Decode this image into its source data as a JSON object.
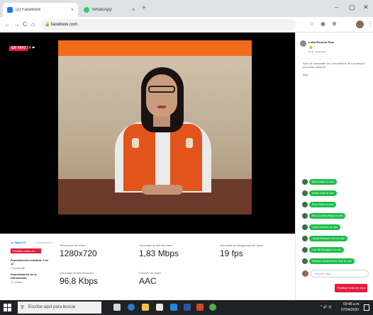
{
  "browser": {
    "tabs": [
      {
        "label": "(2) Facebook",
        "icon": "facebook-icon",
        "close": "×"
      },
      {
        "label": "WhatsApp",
        "icon": "whatsapp-icon",
        "close": "×"
      }
    ],
    "new_tab": "+",
    "window_controls": {
      "minimize": "–",
      "maximize": "▢",
      "close": "✕"
    },
    "nav": {
      "back": "←",
      "forward": "→",
      "reload": "C",
      "home": "⌂"
    },
    "url": "facebook.com",
    "extensions": [
      "☆",
      "◉",
      "⊕",
      "⋮"
    ]
  },
  "live": {
    "badge": "EN VIVO",
    "viewers": "14 ❤"
  },
  "stats": {
    "tab_active": "▲ Stats 5 ▾",
    "tab_other": "Comentarios",
    "end_small": "Finalizar video en directo (h)",
    "side_label_1": "Reproducción máxima: 6 de 12",
    "side_sub_1": "2 personas",
    "side_label_2": "Espectadores de la transmisión",
    "side_sub_2": "17 vistas",
    "items": [
      {
        "label": "Resolución de video",
        "value": "1280x720"
      },
      {
        "label": "Velocidad de bits del video",
        "value": "1,83 Mbps"
      },
      {
        "label": "Velocidad de fotogramas del video",
        "value": "19 fps"
      },
      {
        "label": "Velocidad de bits del audio",
        "value": "96,8 Kbps"
      },
      {
        "label": "Formato de audio",
        "value": "AAC"
      }
    ]
  },
  "chat": {
    "comment": {
      "name": "Luisa Ricardo Ruiz",
      "emoji": "👍",
      "time": "2 min · Responder"
    },
    "note": "Solo se mostrarán los comentarios de tus amigos que sean públicos",
    "note_link": "Más",
    "joins": [
      "Mis Rosales se unió",
      "Noemí Ruiz se unió",
      "Rosa Rivas se unió",
      "Raúl Zavaleta Mejía se unió",
      "Lidia Escobedo se unió",
      "Yamila Márquez Cruz se unió",
      "Luis Yili Rodríguez se unió",
      "Roberta Camila Muñoz Díaz se unió"
    ],
    "input_placeholder": "Escribe algo...",
    "end_button": "Finalizar video en vivo"
  },
  "taskbar": {
    "search_placeholder": "Escribe aquí para buscar",
    "tray": "^ 🔊 ⊡",
    "time": "09:45 a.m.",
    "date": "07/04/2020"
  },
  "colors": {
    "facebook_blue": "#1877f2",
    "live_red": "#e41e3f",
    "join_green": "#1fbd4a",
    "video_orange": "#f26a1b"
  }
}
